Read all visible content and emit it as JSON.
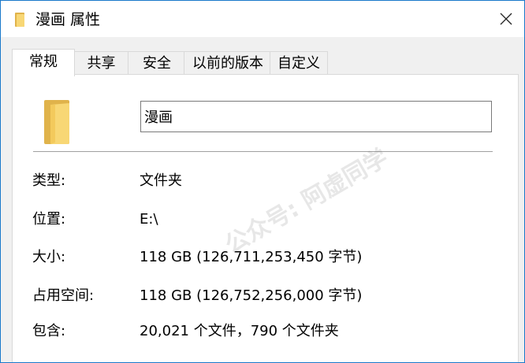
{
  "window": {
    "title": "漫画 属性"
  },
  "tabs": [
    {
      "label": "常规",
      "active": true
    },
    {
      "label": "共享",
      "active": false
    },
    {
      "label": "安全",
      "active": false
    },
    {
      "label": "以前的版本",
      "active": false
    },
    {
      "label": "自定义",
      "active": false
    }
  ],
  "general": {
    "name_value": "漫画",
    "rows": [
      {
        "label": "类型:",
        "value": "文件夹"
      },
      {
        "label": "位置:",
        "value": "E:\\"
      },
      {
        "label": "大小:",
        "value": "118 GB (126,711,253,450 字节)"
      },
      {
        "label": "占用空间:",
        "value": "118 GB (126,752,256,000 字节)"
      },
      {
        "label": "包含:",
        "value": "20,021 个文件，790 个文件夹"
      }
    ]
  },
  "watermark": {
    "text": "公众号: 阿虚同学"
  },
  "colors": {
    "window_border": "#1979ca",
    "folder_yellow": "#f8d775",
    "folder_shade": "#e0b34b"
  },
  "icons": {
    "title": "folder-icon",
    "close": "close-icon",
    "large_folder": "folder-icon"
  }
}
